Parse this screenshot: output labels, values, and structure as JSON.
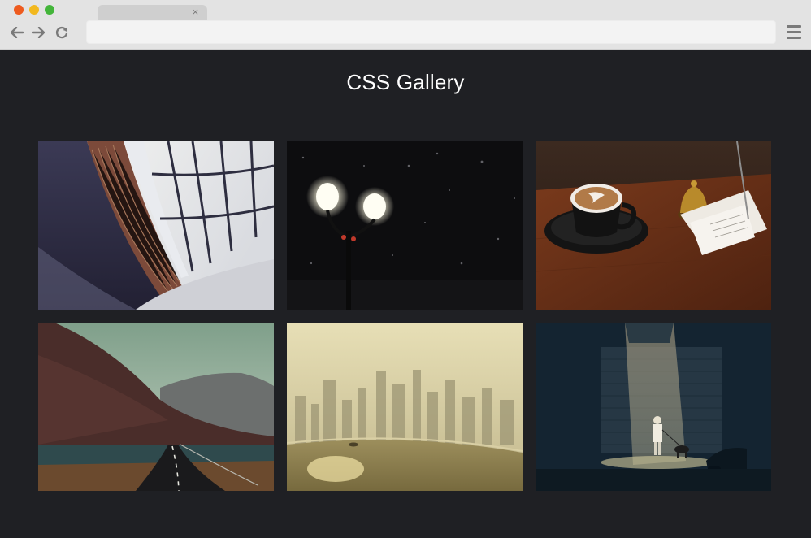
{
  "browser": {
    "tab_close": "×",
    "url": ""
  },
  "page": {
    "title": "CSS Gallery"
  },
  "gallery": {
    "photos": [
      {
        "subject": "library-photo"
      },
      {
        "subject": "street-lamps-photo"
      },
      {
        "subject": "coffee-photo"
      },
      {
        "subject": "mountain-road-photo"
      },
      {
        "subject": "hazy-city-photo"
      },
      {
        "subject": "night-walk-photo"
      }
    ]
  },
  "colors": {
    "background": "#1f2024",
    "chrome": "#e3e3e3",
    "title_text": "#ffffff"
  }
}
